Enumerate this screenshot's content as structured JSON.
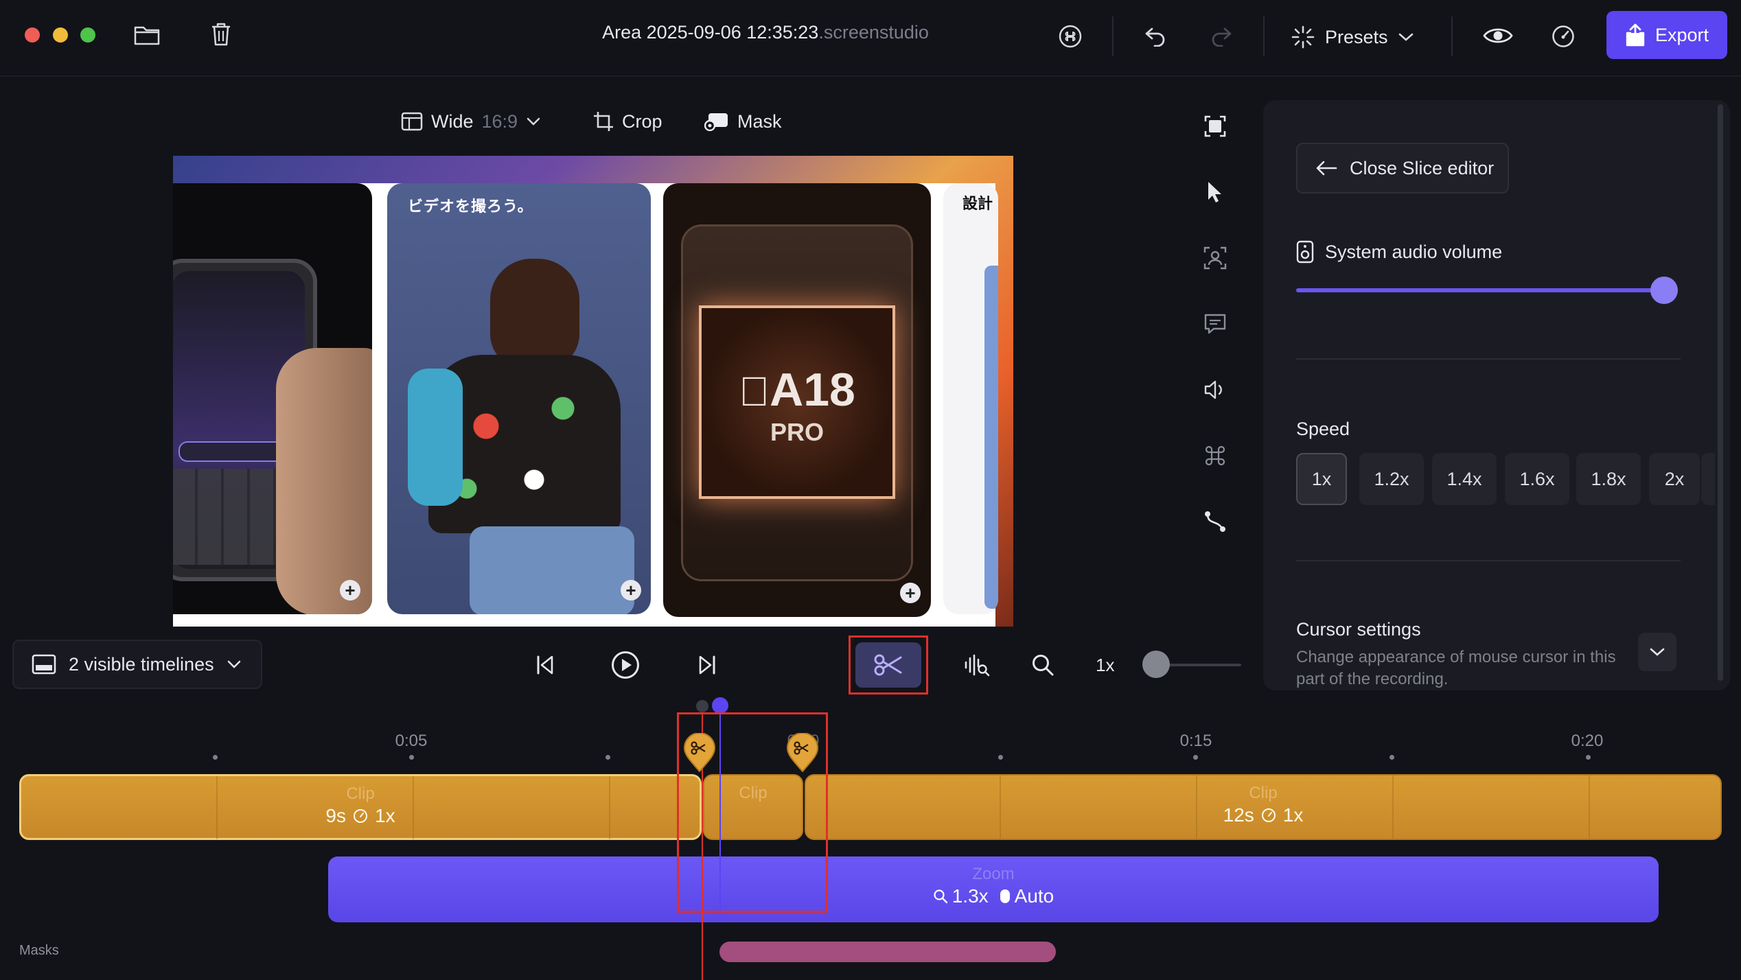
{
  "window": {
    "title": "Area 2025-09-06 12:35:23",
    "title_ext": ".screenstudio"
  },
  "toolbar": {
    "presets_label": "Presets",
    "export_label": "Export"
  },
  "canvas_toolbar": {
    "aspect_label": "Wide",
    "aspect_ratio": "16:9",
    "crop_label": "Crop",
    "mask_label": "Mask"
  },
  "preview": {
    "card1_title": "ビデオを撮ろう。",
    "card3_chip_name": "A18",
    "card3_chip_sub": "PRO",
    "card4_title": "設計"
  },
  "panel": {
    "close_slice_label": "Close Slice editor",
    "audio_label": "System audio volume",
    "audio_volume": 1.0,
    "speed_label": "Speed",
    "speed_options": [
      "1x",
      "1.2x",
      "1.4x",
      "1.6x",
      "1.8x",
      "2x"
    ],
    "speed_selected": "1x",
    "cursor_title": "Cursor settings",
    "cursor_desc": "Change appearance of mouse cursor in this part of the recording."
  },
  "transport": {
    "visible_timelines_label": "2 visible timelines",
    "playback_speed": "1x"
  },
  "timeline": {
    "ticks": [
      "0:05",
      "0:15",
      "0:20"
    ],
    "ticks_partial": "0:10",
    "clips": [
      {
        "label": "Clip",
        "duration": "9s",
        "speed": "1x"
      },
      {
        "label": "Clip",
        "duration": "",
        "speed": ""
      },
      {
        "label": "Clip",
        "duration": "12s",
        "speed": "1x"
      }
    ],
    "zoom": {
      "label": "Zoom",
      "level": "1.3x",
      "mode": "Auto"
    },
    "masks_label": "Masks"
  },
  "colors": {
    "accent": "#5b44f2",
    "clip": "#d79b32",
    "zoom": "#6b58f5",
    "mask": "#a34e7e",
    "highlight": "#e0302a"
  }
}
